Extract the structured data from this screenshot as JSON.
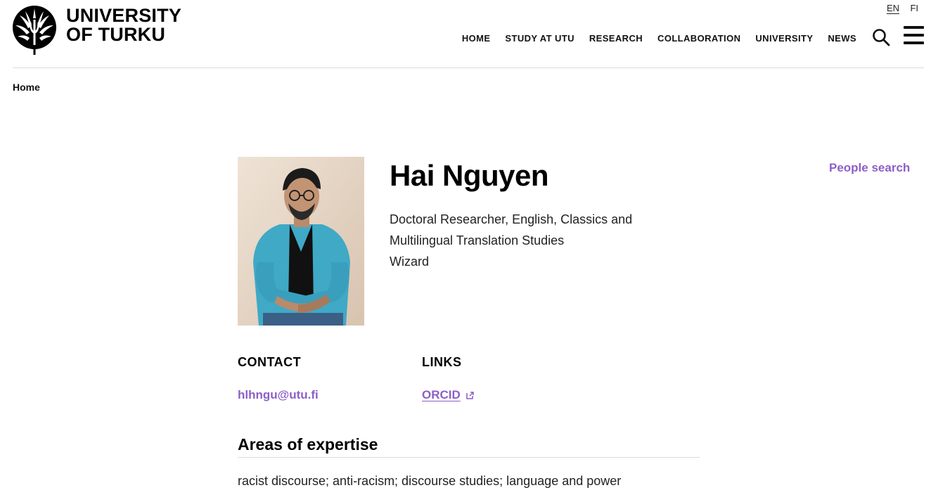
{
  "header": {
    "logo_line1": "UNIVERSITY",
    "logo_line2": "OF TURKU",
    "languages": [
      "EN",
      "FI"
    ],
    "nav": [
      "HOME",
      "STUDY AT UTU",
      "RESEARCH",
      "COLLABORATION",
      "UNIVERSITY",
      "NEWS"
    ],
    "search_icon": "search-icon",
    "menu_icon": "hamburger-menu-icon"
  },
  "breadcrumb": {
    "home": "Home"
  },
  "profile": {
    "name": "Hai Nguyen",
    "title_line1": "Doctoral Researcher, English, Classics and",
    "title_line2": "Multilingual Translation Studies",
    "title_line3": "Wizard",
    "people_search": "People search"
  },
  "contact": {
    "heading": "CONTACT",
    "email": "hlhngu@utu.fi"
  },
  "links": {
    "heading": "LINKS",
    "orcid": "ORCID",
    "external_icon": "external-link-icon"
  },
  "expertise": {
    "heading": "Areas of expertise",
    "text": "racist discourse; anti-racism; discourse studies; language and power"
  },
  "colors": {
    "accent": "#8c5fc9",
    "text": "#111111",
    "divider": "#dcdcdc"
  }
}
